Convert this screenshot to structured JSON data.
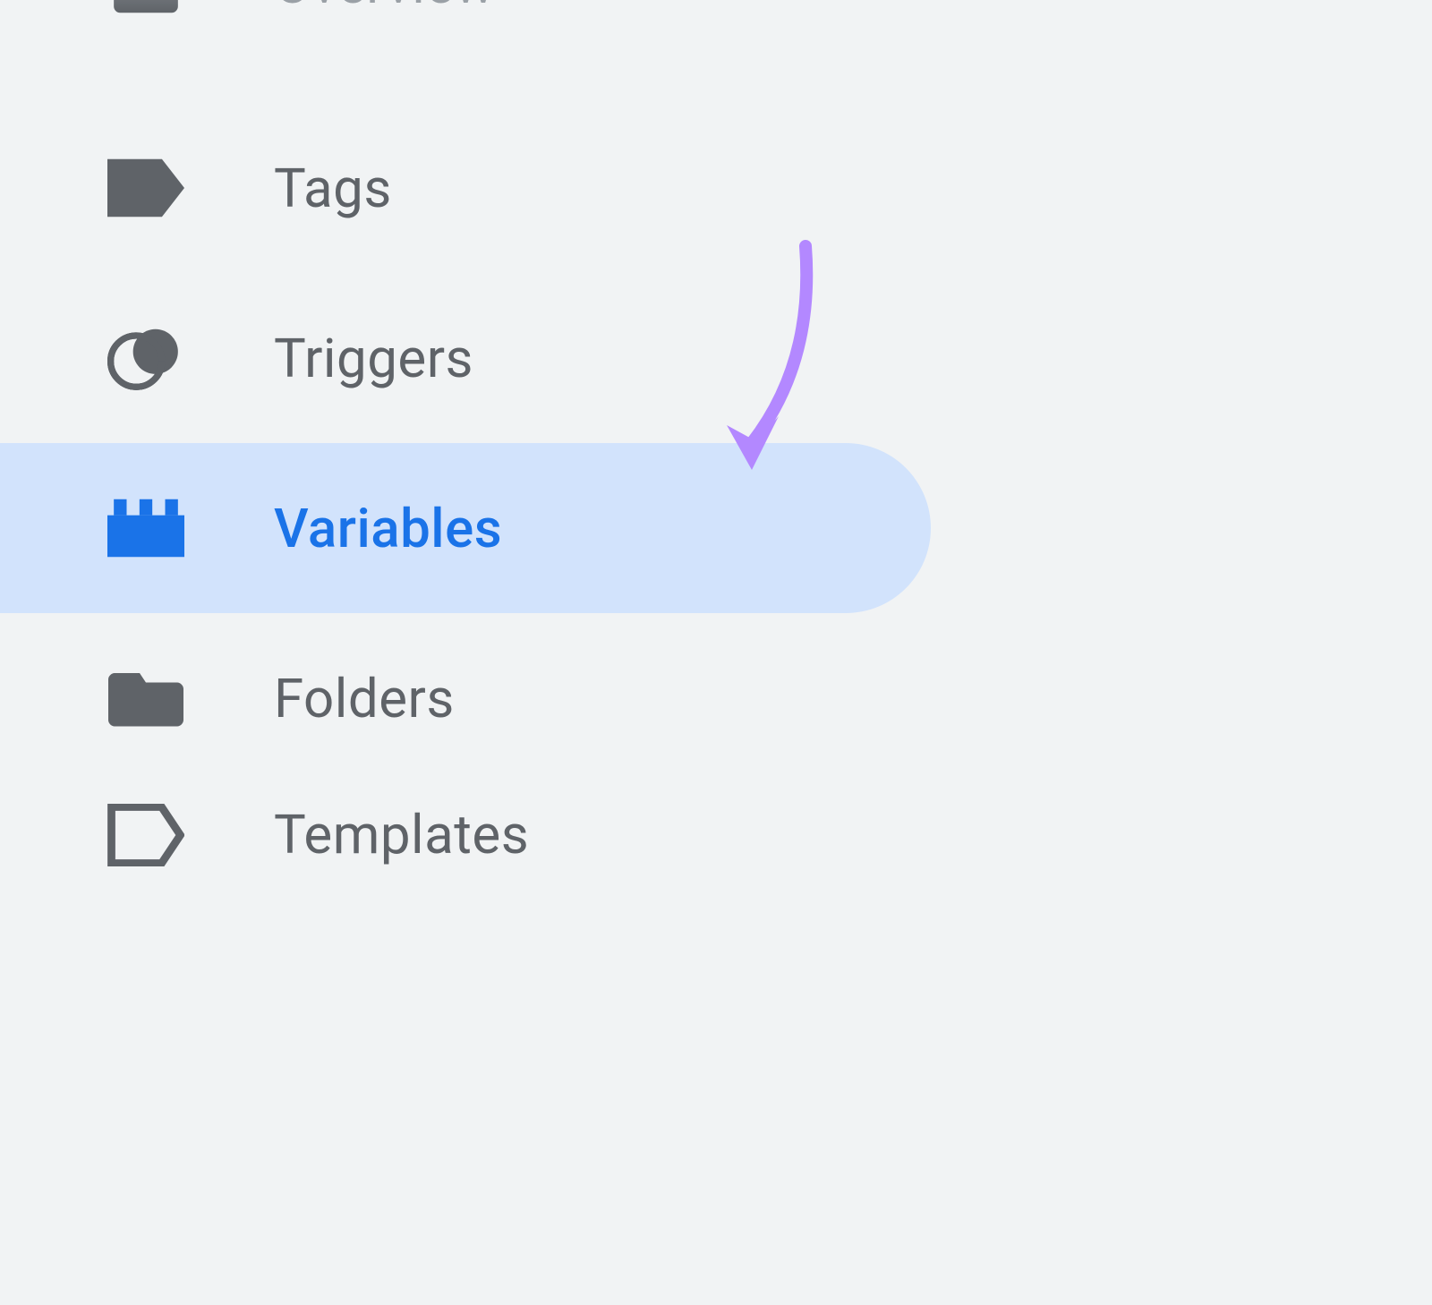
{
  "sidebar": {
    "items": [
      {
        "label": "Overview",
        "icon": "briefcase",
        "active": false,
        "faded": true
      },
      {
        "label": "Tags",
        "icon": "tag",
        "active": false,
        "faded": false
      },
      {
        "label": "Triggers",
        "icon": "triggers",
        "active": false,
        "faded": false
      },
      {
        "label": "Variables",
        "icon": "lego",
        "active": true,
        "faded": false
      },
      {
        "label": "Folders",
        "icon": "folder",
        "active": false,
        "faded": false
      },
      {
        "label": "Templates",
        "icon": "template",
        "active": false,
        "faded": false
      }
    ]
  },
  "annotation": {
    "arrow_color": "#b388ff"
  }
}
